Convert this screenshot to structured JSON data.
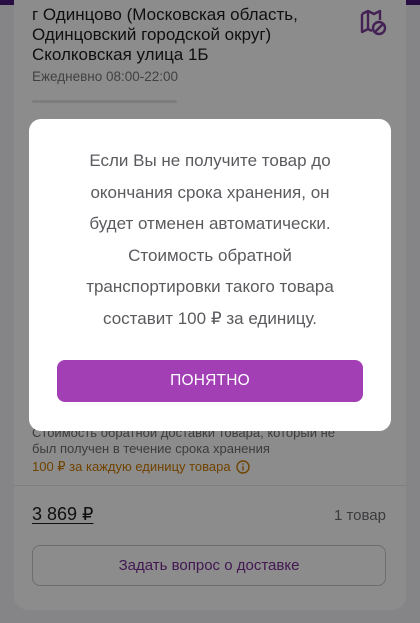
{
  "pickup": {
    "address_lines": [
      "г Одинцово (Московская область,",
      "Одинцовский городской округ)",
      "Сколковская улица 1Б"
    ],
    "hours": "Ежедневно 08:00-22:00"
  },
  "return_info": {
    "note_lines": [
      "Стоимость обратной доставки товара, который не",
      "был получен в течение срока хранения"
    ],
    "fee": "100 ₽ за каждую единицу товара"
  },
  "summary": {
    "price": "3 869 ₽",
    "quantity": "1 товар"
  },
  "ask_button_label": "Задать вопрос о доставке",
  "dialog": {
    "lines": [
      "Если Вы не получите товар до",
      "окончания срока хранения, он",
      "будет отменен автоматически.",
      "Стоимость обратной",
      "транспортировки такого товара",
      "составит 100 ₽ за единицу."
    ],
    "confirm_label": "ПОНЯТНО"
  },
  "colors": {
    "accent": "#a23fb5",
    "brand_dark": "#4b1a7a",
    "warning": "#cc7a00"
  },
  "icons": [
    "map-off-icon",
    "info-icon"
  ]
}
